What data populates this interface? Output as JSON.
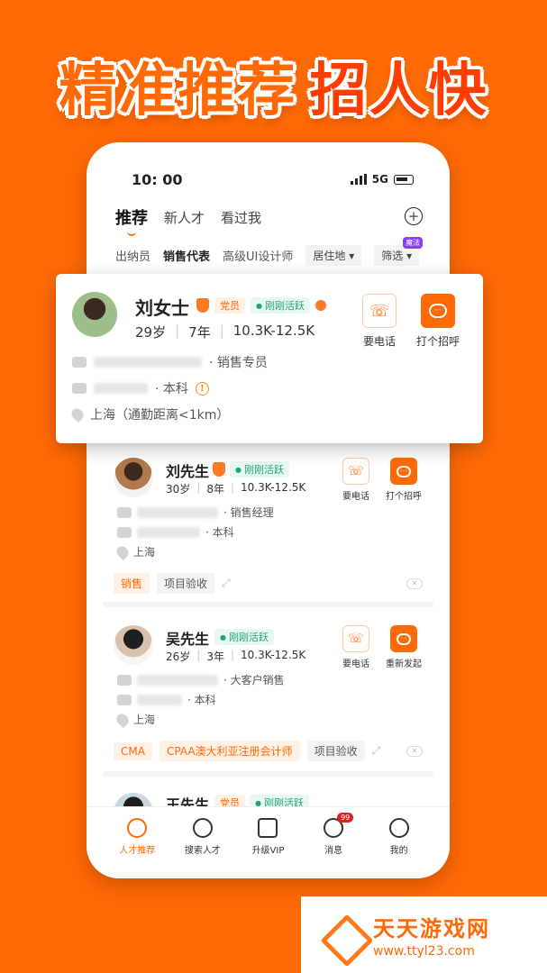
{
  "headline": {
    "part1": "精准推荐",
    "part2": "招人快"
  },
  "status": {
    "time": "10: 00",
    "network": "5G"
  },
  "tabs": [
    "推荐",
    "新人才",
    "看过我"
  ],
  "filters": {
    "items": [
      "出纳员",
      "销售代表",
      "高级UI设计师"
    ],
    "residence": "居住地",
    "screen": "筛选",
    "screen_badge": "魔法"
  },
  "highlight": {
    "name": "刘女士",
    "party": "党员",
    "active": "刚刚活跃",
    "age": "29岁",
    "years": "7年",
    "salary": "10.3K-12.5K",
    "job": "· 销售专员",
    "edu": "· 本科",
    "loc": "上海（通勤距离<1km）",
    "call": "要电话",
    "greet": "打个招呼"
  },
  "cards": [
    {
      "name": "刘先生",
      "active": "刚刚活跃",
      "age": "30岁",
      "years": "8年",
      "salary": "10.3K-12.5K",
      "job": "· 销售经理",
      "edu": "· 本科",
      "loc": "上海",
      "call": "要电话",
      "greet": "打个招呼",
      "skills": [
        "销售",
        "项目验收"
      ]
    },
    {
      "name": "吴先生",
      "active": "刚刚活跃",
      "age": "26岁",
      "years": "3年",
      "salary": "10.3K-12.5K",
      "job": "· 大客户销售",
      "edu": "· 本科",
      "loc": "上海",
      "call": "要电话",
      "greet": "重新发起",
      "skills": [
        "CMA",
        "CPAA澳大利亚注册会计师",
        "项目验收"
      ]
    },
    {
      "name": "王先生",
      "party": "党员",
      "active": "刚刚活跃"
    }
  ],
  "nav": [
    {
      "label": "人才推荐",
      "active": true
    },
    {
      "label": "搜索人才"
    },
    {
      "label": "升级VIP"
    },
    {
      "label": "消息",
      "badge": "99"
    },
    {
      "label": "我的"
    }
  ],
  "watermark": {
    "title": "天天游戏网",
    "url": "www.ttyl23.com"
  },
  "colors": {
    "brand": "#ff6a06",
    "active_green": "#1ea67a"
  }
}
